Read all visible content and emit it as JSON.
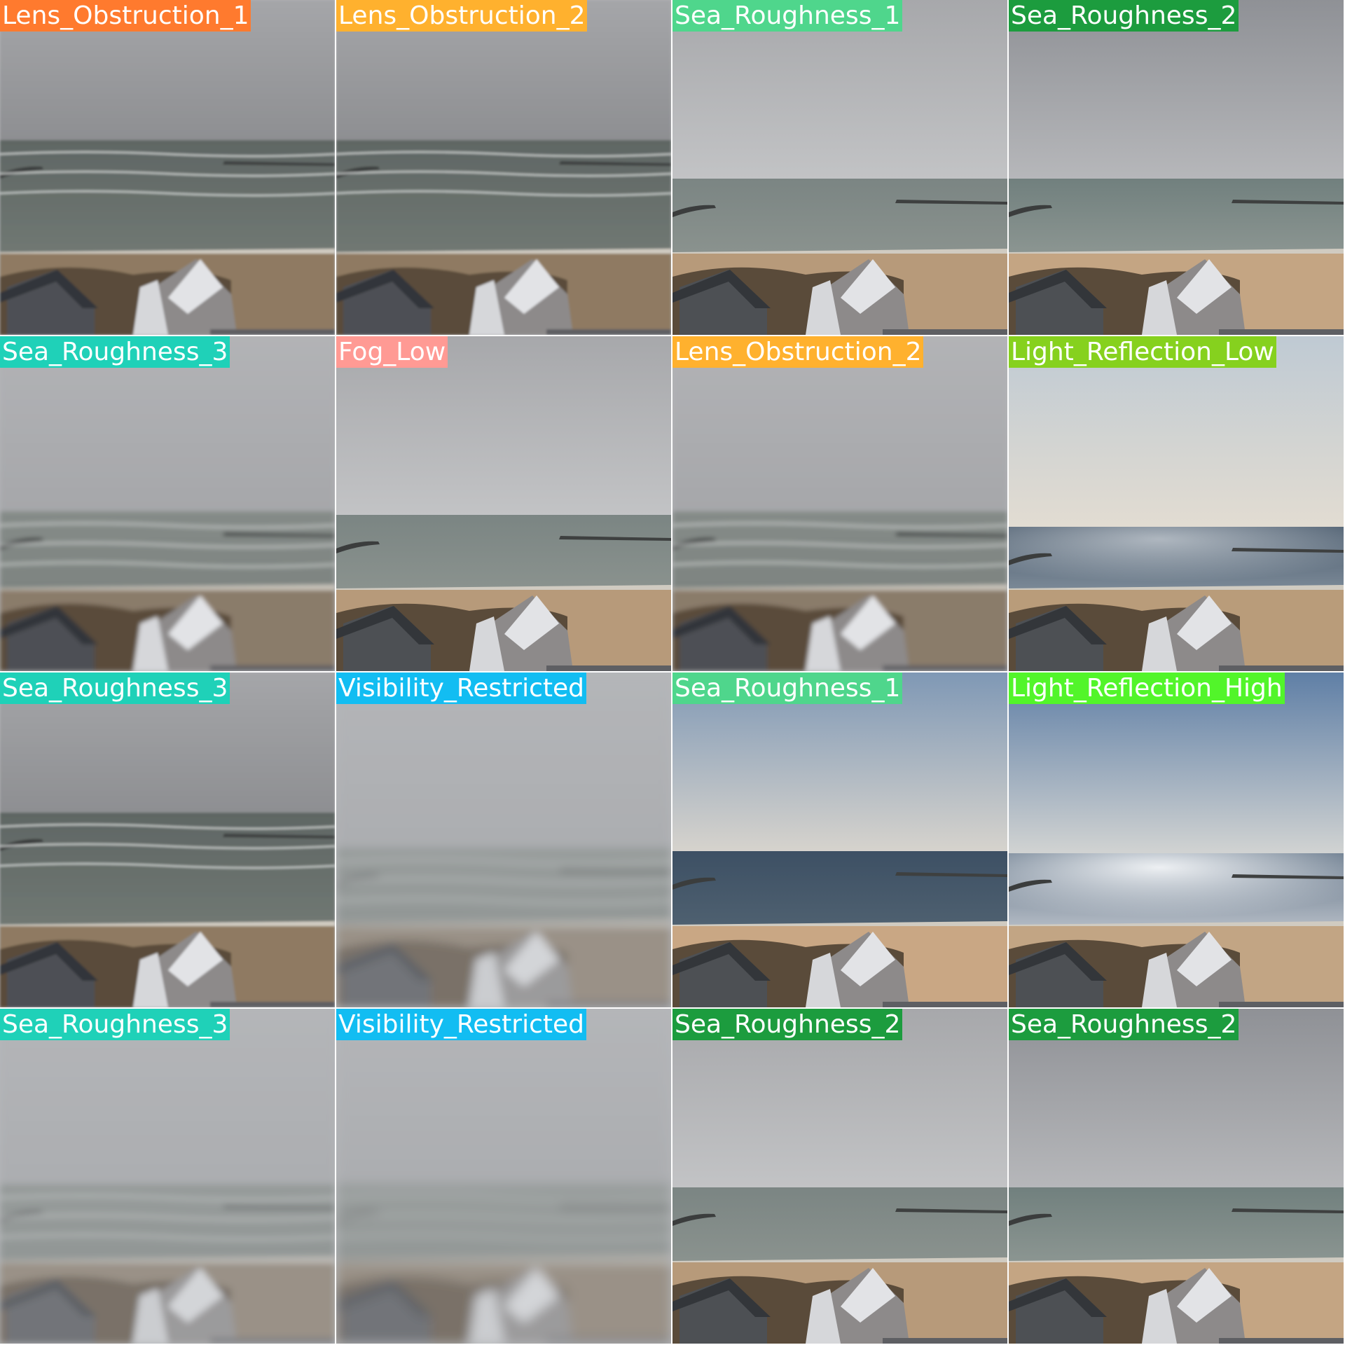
{
  "tiles": [
    {
      "label": "Lens_Obstruction_1",
      "color": "#ff7a2e",
      "scene": "storm",
      "blur": 1
    },
    {
      "label": "Lens_Obstruction_2",
      "color": "#ffb12e",
      "scene": "storm",
      "blur": 1
    },
    {
      "label": "Sea_Roughness_1",
      "color": "#4fd68c",
      "scene": "overcast",
      "blur": 0
    },
    {
      "label": "Sea_Roughness_2",
      "color": "#1c9c3e",
      "scene": "overcast-dark",
      "blur": 0
    },
    {
      "label": "Sea_Roughness_3",
      "color": "#1fd1b8",
      "scene": "fog",
      "blur": 2
    },
    {
      "label": "Fog_Low",
      "color": "#ff9a94",
      "scene": "overcast",
      "blur": 0
    },
    {
      "label": "Lens_Obstruction_2",
      "color": "#ffb12e",
      "scene": "fog",
      "blur": 2
    },
    {
      "label": "Light_Reflection_Low",
      "color": "#86d11e",
      "scene": "sunny-glare",
      "blur": 0
    },
    {
      "label": "Sea_Roughness_3",
      "color": "#1fd1b8",
      "scene": "storm",
      "blur": 1
    },
    {
      "label": "Visibility_Restricted",
      "color": "#12bdf2",
      "scene": "fog",
      "blur": 4
    },
    {
      "label": "Sea_Roughness_1",
      "color": "#4fd68c",
      "scene": "clear",
      "blur": 0
    },
    {
      "label": "Light_Reflection_High",
      "color": "#52f52a",
      "scene": "bright-glare",
      "blur": 0
    },
    {
      "label": "Sea_Roughness_3",
      "color": "#1fd1b8",
      "scene": "fog",
      "blur": 3
    },
    {
      "label": "Visibility_Restricted",
      "color": "#12bdf2",
      "scene": "fog",
      "blur": 5
    },
    {
      "label": "Sea_Roughness_2",
      "color": "#1c9c3e",
      "scene": "overcast",
      "blur": 0
    },
    {
      "label": "Sea_Roughness_2",
      "color": "#1c9c3e",
      "scene": "overcast-dark",
      "blur": 0
    }
  ]
}
